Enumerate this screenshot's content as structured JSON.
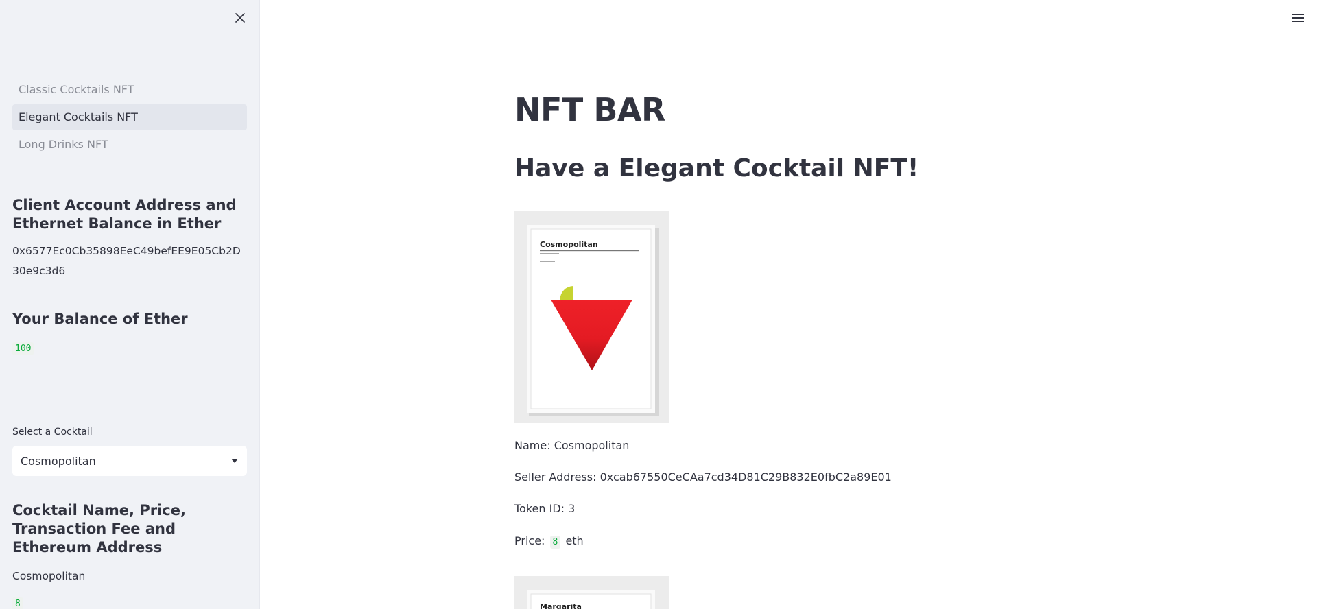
{
  "sidebar": {
    "nav": [
      {
        "label": "Classic Cocktails NFT",
        "active": false
      },
      {
        "label": "Elegant Cocktails NFT",
        "active": true
      },
      {
        "label": "Long Drinks NFT",
        "active": false
      }
    ],
    "account_header": "Client Account Address and Ethernet Balance in Ether",
    "account_address": "0x6577Ec0Cb35898EeC49befEE9E05Cb2D30e9c3d6",
    "balance_header": "Your Balance of Ether",
    "balance_value": "100",
    "select_label": "Select a Cocktail",
    "select_value": "Cosmopolitan",
    "details_header": "Cocktail Name, Price, Transaction Fee and Ethereum Address",
    "details_name": "Cosmopolitan",
    "details_price": "8"
  },
  "main": {
    "title": "NFT BAR",
    "subtitle": "Have a Elegant Cocktail NFT!",
    "nft": {
      "poster_title": "Cosmopolitan",
      "next_poster_title": "Margarita",
      "name_label": "Name:",
      "name": "Cosmopolitan",
      "seller_label": "Seller Address:",
      "seller": "0xcab67550CeCAa7cd34D81C29B832E0fbC2a89E01",
      "token_label": "Token ID:",
      "token_id": "3",
      "price_label": "Price:",
      "price": "8",
      "price_unit": "eth"
    }
  },
  "colors": {
    "sidebar_bg": "#f0f2f6",
    "text": "#31333f",
    "code_green": "#09ab3b",
    "cocktail_red": "#e41b23",
    "lime": "#c6d331"
  },
  "icons": {
    "close": "close-icon",
    "menu": "hamburger-menu-icon",
    "dropdown": "chevron-down-icon"
  }
}
